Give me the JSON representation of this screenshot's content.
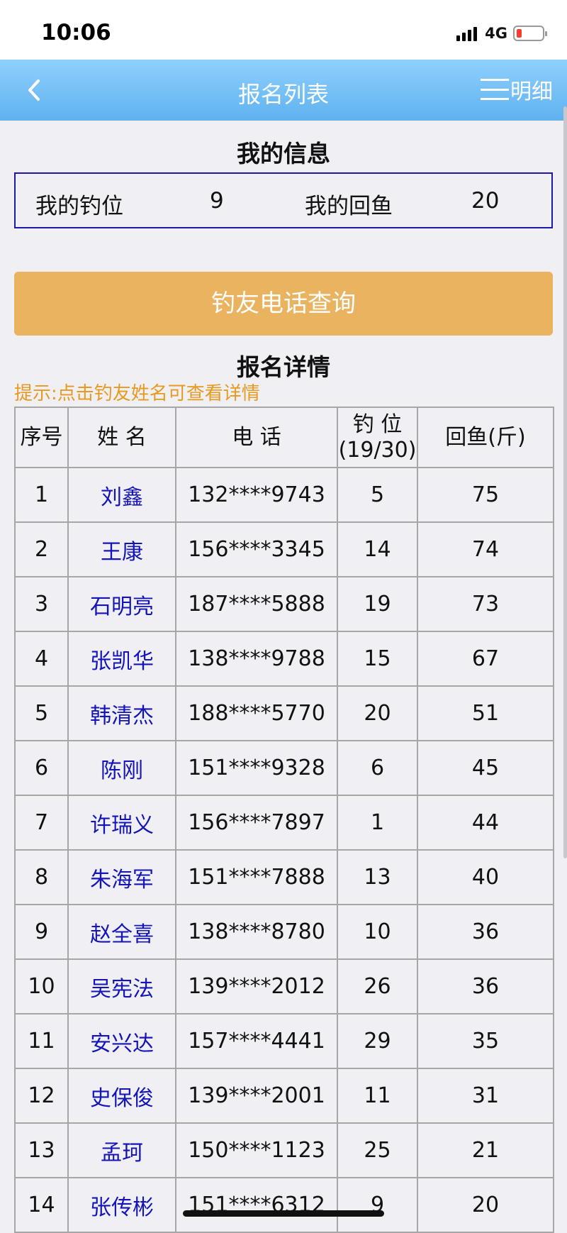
{
  "status_bar": {
    "time": "10:06",
    "network": "4G"
  },
  "navbar": {
    "title": "报名列表",
    "detail_label": "明细"
  },
  "my_info": {
    "title": "我的信息",
    "spot_label": "我的钓位",
    "spot_value": "9",
    "catch_label": "我的回鱼",
    "catch_value": "20"
  },
  "query_button": "钓友电话查询",
  "details": {
    "title": "报名详情",
    "tip": "提示:点击钓友姓名可查看详情"
  },
  "table": {
    "headers": {
      "index": "序号",
      "name": "姓 名",
      "phone": "电 话",
      "spot": "钓 位",
      "spot_count": "(19/30)",
      "catch": "回鱼(斤)"
    },
    "rows": [
      {
        "index": "1",
        "name": "刘鑫",
        "phone": "132****9743",
        "spot": "5",
        "catch": "75"
      },
      {
        "index": "2",
        "name": "王康",
        "phone": "156****3345",
        "spot": "14",
        "catch": "74"
      },
      {
        "index": "3",
        "name": "石明亮",
        "phone": "187****5888",
        "spot": "19",
        "catch": "73"
      },
      {
        "index": "4",
        "name": "张凯华",
        "phone": "138****9788",
        "spot": "15",
        "catch": "67"
      },
      {
        "index": "5",
        "name": "韩清杰",
        "phone": "188****5770",
        "spot": "20",
        "catch": "51"
      },
      {
        "index": "6",
        "name": "陈刚",
        "phone": "151****9328",
        "spot": "6",
        "catch": "45"
      },
      {
        "index": "7",
        "name": "许瑞义",
        "phone": "156****7897",
        "spot": "1",
        "catch": "44"
      },
      {
        "index": "8",
        "name": "朱海军",
        "phone": "151****7888",
        "spot": "13",
        "catch": "40"
      },
      {
        "index": "9",
        "name": "赵全喜",
        "phone": "138****8780",
        "spot": "10",
        "catch": "36"
      },
      {
        "index": "10",
        "name": "吴宪法",
        "phone": "139****2012",
        "spot": "26",
        "catch": "36"
      },
      {
        "index": "11",
        "name": "安兴达",
        "phone": "157****4441",
        "spot": "29",
        "catch": "35"
      },
      {
        "index": "12",
        "name": "史保俊",
        "phone": "139****2001",
        "spot": "11",
        "catch": "31"
      },
      {
        "index": "13",
        "name": "孟珂",
        "phone": "150****1123",
        "spot": "25",
        "catch": "21"
      },
      {
        "index": "14",
        "name": "张传彬",
        "phone": "151****6312",
        "spot": "9",
        "catch": "20"
      }
    ]
  },
  "colors": {
    "nav_bar": "#6dbdf3",
    "query_button": "#e9b35f",
    "tip_text": "#e79a1e",
    "name_link": "#1414b8",
    "info_border": "#1a1aa6"
  }
}
